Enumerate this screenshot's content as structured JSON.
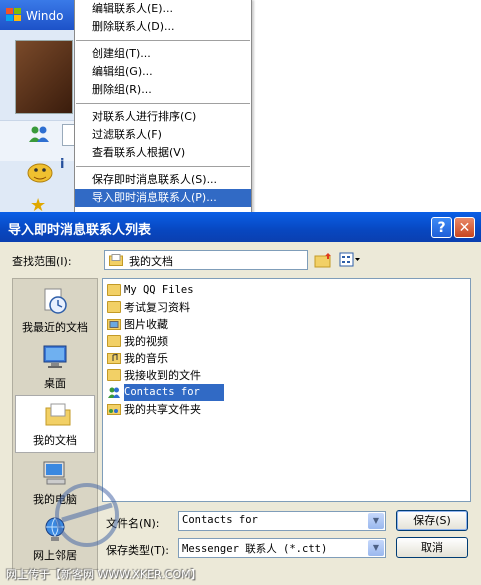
{
  "background_window": {
    "title": "Windo"
  },
  "context_menu": {
    "items": [
      {
        "label": "编辑联系人(E)..."
      },
      {
        "label": "删除联系人(D)..."
      },
      {
        "label": "创建组(T)..."
      },
      {
        "label": "编辑组(G)..."
      },
      {
        "label": "删除组(R)..."
      },
      {
        "label": "对联系人进行排序(C)"
      },
      {
        "label": "过滤联系人(F)"
      },
      {
        "label": "查看联系人根据(V)"
      },
      {
        "label": "保存即时消息联系人(S)..."
      },
      {
        "label": "导入即时消息联系人(P)..."
      }
    ],
    "highlighted": "导入即时消息联系人(P)..."
  },
  "dialog": {
    "title": "导入即时消息联系人列表",
    "help_button": "?",
    "close_button": "✕",
    "look_in_label": "查找范围(I):",
    "look_in_value": "我的文档",
    "places": [
      {
        "label": "我最近的文档",
        "icon": "recent-documents-icon"
      },
      {
        "label": "桌面",
        "icon": "desktop-icon"
      },
      {
        "label": "我的文档",
        "icon": "my-documents-icon"
      },
      {
        "label": "我的电脑",
        "icon": "my-computer-icon"
      },
      {
        "label": "网上邻居",
        "icon": "network-places-icon"
      }
    ],
    "files": [
      {
        "name": "My QQ Files",
        "icon": "folder-icon"
      },
      {
        "name": "考试复习资料",
        "icon": "folder-icon"
      },
      {
        "name": "图片收藏",
        "icon": "pictures-folder-icon"
      },
      {
        "name": "我的视频",
        "icon": "folder-icon"
      },
      {
        "name": "我的音乐",
        "icon": "music-folder-icon"
      },
      {
        "name": "我接收到的文件",
        "icon": "folder-icon"
      },
      {
        "name": "Contacts for",
        "icon": "contacts-file-icon"
      },
      {
        "name": "我的共享文件夹",
        "icon": "shared-folder-icon"
      }
    ],
    "selected_file": "Contacts for",
    "file_name_label": "文件名(N):",
    "file_name_value": "Contacts for",
    "file_type_label": "保存类型(T):",
    "file_type_value": "Messenger 联系人 (*.ctt)",
    "save_button": "保存(S)",
    "cancel_button": "取消"
  },
  "watermark": {
    "text": "网上传于【新客网 WWW.XKER.COM】"
  },
  "colors": {
    "selection": "#316ac5",
    "dialog_bg": "#ece9d8",
    "titlebar": "#0a5fe6"
  }
}
